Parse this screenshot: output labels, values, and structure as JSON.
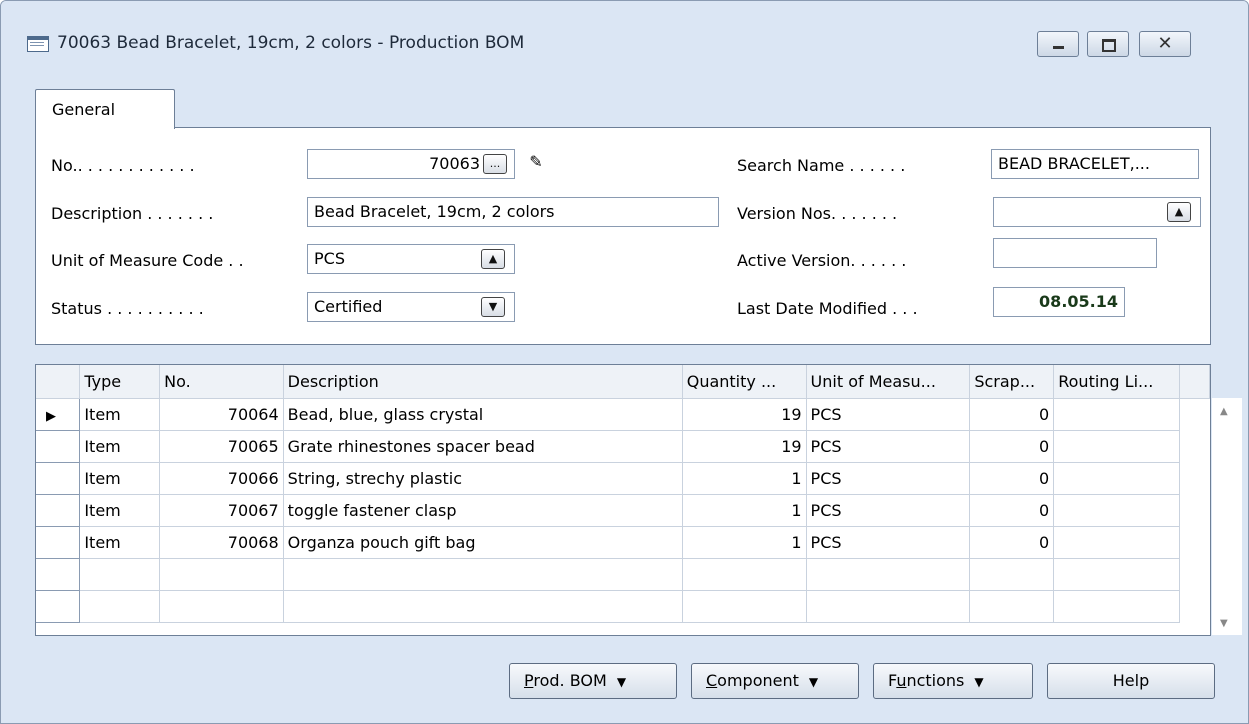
{
  "window": {
    "title": "70063 Bead Bracelet, 19cm, 2 colors - Production BOM",
    "close_glyph": "✕"
  },
  "tabs": [
    {
      "label": "General"
    }
  ],
  "general": {
    "no_label": "No.. . . . . . . . . . . .",
    "no_value": "70063",
    "description_label": "Description . . . . . . .",
    "description_value": "Bead Bracelet, 19cm, 2 colors",
    "uom_label": "Unit of Measure Code . .",
    "uom_value": "PCS",
    "status_label": "Status . . . . . . . . . .",
    "status_value": "Certified",
    "search_name_label": "Search Name . . . . . .",
    "search_name_value": "BEAD BRACELET,...",
    "version_nos_label": "Version Nos. . . . . . .",
    "version_nos_value": "",
    "active_version_label": "Active Version. . . . . .",
    "active_version_value": "",
    "last_date_label": "Last Date Modified . . .",
    "last_date_value": "08.05.14",
    "assist_glyph": "...",
    "lookup_glyph": "▲",
    "dropdown_glyph": "▼",
    "edit_glyph": "✎"
  },
  "lines": {
    "columns": [
      "Type",
      "No.",
      "Description",
      "Quantity ...",
      "Unit of Measu...",
      "Scrap...",
      "Routing Li..."
    ],
    "current_row_glyph": "▶",
    "rows": [
      {
        "type": "Item",
        "no": "70064",
        "description": "Bead, blue, glass crystal",
        "quantity": "19",
        "uom": "PCS",
        "scrap": "0",
        "routing": ""
      },
      {
        "type": "Item",
        "no": "70065",
        "description": "Grate rhinestones spacer bead",
        "quantity": "19",
        "uom": "PCS",
        "scrap": "0",
        "routing": ""
      },
      {
        "type": "Item",
        "no": "70066",
        "description": "String, strechy plastic",
        "quantity": "1",
        "uom": "PCS",
        "scrap": "0",
        "routing": ""
      },
      {
        "type": "Item",
        "no": "70067",
        "description": "toggle fastener clasp",
        "quantity": "1",
        "uom": "PCS",
        "scrap": "0",
        "routing": ""
      },
      {
        "type": "Item",
        "no": "70068",
        "description": "Organza pouch gift bag",
        "quantity": "1",
        "uom": "PCS",
        "scrap": "0",
        "routing": ""
      },
      {
        "type": "",
        "no": "",
        "description": "",
        "quantity": "",
        "uom": "",
        "scrap": "",
        "routing": ""
      },
      {
        "type": "",
        "no": "",
        "description": "",
        "quantity": "",
        "uom": "",
        "scrap": "",
        "routing": ""
      }
    ]
  },
  "buttons": {
    "prod_bom_u": "P",
    "prod_bom_rest": "rod. BOM",
    "component_u": "C",
    "component_rest": "omponent",
    "functions_pre": "F",
    "functions_u": "u",
    "functions_rest": "nctions",
    "help": "Help",
    "dropdown_glyph": "▼"
  }
}
